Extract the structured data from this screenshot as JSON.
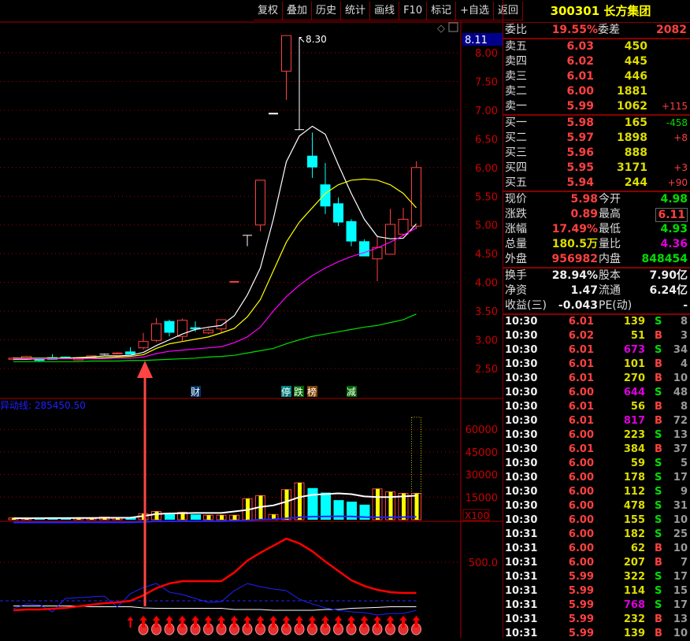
{
  "toolbar": [
    "复权",
    "叠加",
    "历史",
    "统计",
    "画线",
    "F10",
    "标记",
    "+自选",
    "返回"
  ],
  "stock": {
    "title": "300301 长方集团"
  },
  "weibi": {
    "label": "委比",
    "value": "19.55%",
    "label2": "委差",
    "value2": "2082"
  },
  "sell": [
    {
      "label": "卖五",
      "price": "6.03",
      "vol": "450",
      "chg": ""
    },
    {
      "label": "卖四",
      "price": "6.02",
      "vol": "445",
      "chg": ""
    },
    {
      "label": "卖三",
      "price": "6.01",
      "vol": "446",
      "chg": ""
    },
    {
      "label": "卖二",
      "price": "6.00",
      "vol": "1881",
      "chg": ""
    },
    {
      "label": "卖一",
      "price": "5.99",
      "vol": "1062",
      "chg": "+115"
    }
  ],
  "buy": [
    {
      "label": "买一",
      "price": "5.98",
      "vol": "165",
      "chg": "-458"
    },
    {
      "label": "买二",
      "price": "5.97",
      "vol": "1898",
      "chg": "+8"
    },
    {
      "label": "买三",
      "price": "5.96",
      "vol": "888",
      "chg": ""
    },
    {
      "label": "买四",
      "price": "5.95",
      "vol": "3171",
      "chg": "+3"
    },
    {
      "label": "买五",
      "price": "5.94",
      "vol": "244",
      "chg": "+90"
    }
  ],
  "quote": [
    {
      "l1": "现价",
      "v1": "5.98",
      "c1": "red",
      "l2": "今开",
      "v2": "4.98",
      "c2": "grn"
    },
    {
      "l1": "涨跌",
      "v1": "0.89",
      "c1": "red",
      "l2": "最高",
      "v2": "6.11",
      "c2": "red"
    },
    {
      "l1": "涨幅",
      "v1": "17.49%",
      "c1": "red",
      "l2": "最低",
      "v2": "4.93",
      "c2": "grn"
    },
    {
      "l1": "总量",
      "v1": "180.5万",
      "c1": "yel",
      "l2": "量比",
      "v2": "4.36",
      "c2": "mag"
    },
    {
      "l1": "外盘",
      "v1": "956982",
      "c1": "red",
      "l2": "内盘",
      "v2": "848454",
      "c2": "grn"
    }
  ],
  "fund": [
    {
      "l1": "换手",
      "v1": "28.94%",
      "l2": "股本",
      "v2": "7.90亿"
    },
    {
      "l1": "净资",
      "v1": "1.47",
      "l2": "流通",
      "v2": "6.24亿"
    },
    {
      "l1": "收益(三)",
      "v1": "-0.043",
      "l2": "PE(动)",
      "v2": "-"
    }
  ],
  "ticks": [
    [
      "10:30",
      "6.01",
      "139",
      "S",
      "8"
    ],
    [
      "10:30",
      "6.02",
      "51",
      "B",
      "3"
    ],
    [
      "10:30",
      "6.01",
      "673",
      "S",
      "34"
    ],
    [
      "10:30",
      "6.01",
      "101",
      "B",
      "4"
    ],
    [
      "10:30",
      "6.01",
      "270",
      "B",
      "10"
    ],
    [
      "10:30",
      "6.00",
      "644",
      "S",
      "48"
    ],
    [
      "10:30",
      "6.01",
      "56",
      "B",
      "8"
    ],
    [
      "10:30",
      "6.01",
      "817",
      "B",
      "72"
    ],
    [
      "10:30",
      "6.00",
      "223",
      "S",
      "13"
    ],
    [
      "10:30",
      "6.01",
      "384",
      "B",
      "37"
    ],
    [
      "10:30",
      "6.00",
      "59",
      "S",
      "5"
    ],
    [
      "10:30",
      "6.00",
      "178",
      "S",
      "17"
    ],
    [
      "10:30",
      "6.00",
      "112",
      "S",
      "9"
    ],
    [
      "10:30",
      "6.00",
      "478",
      "S",
      "31"
    ],
    [
      "10:30",
      "6.00",
      "155",
      "S",
      "10"
    ],
    [
      "10:31",
      "6.00",
      "182",
      "S",
      "25"
    ],
    [
      "10:31",
      "6.00",
      "62",
      "B",
      "10"
    ],
    [
      "10:31",
      "6.00",
      "207",
      "B",
      "7"
    ],
    [
      "10:31",
      "5.99",
      "322",
      "S",
      "17"
    ],
    [
      "10:31",
      "5.99",
      "114",
      "S",
      "15"
    ],
    [
      "10:31",
      "5.99",
      "768",
      "S",
      "17"
    ],
    [
      "10:31",
      "5.99",
      "232",
      "B",
      "13"
    ],
    [
      "10:31",
      "5.99",
      "139",
      "B",
      "10"
    ]
  ],
  "chart_labels": {
    "high_marker": "8.30",
    "current_axis": "8.11",
    "vol_title": "异动线: 285450.50",
    "vol_unit": "X100",
    "ind_axis": "500.0",
    "tags": [
      {
        "text": "财",
        "bg": "#003366"
      },
      {
        "text": "停",
        "bg": "#008080"
      },
      {
        "text": "跌",
        "bg": "#006600"
      },
      {
        "text": "榜",
        "bg": "#804000"
      },
      {
        "text": "减",
        "bg": "#006600"
      }
    ]
  },
  "colors": {
    "up": "#ff4040",
    "down": "#00ffff",
    "ma5": "#ffffff",
    "ma10": "#ffff00",
    "ma20": "#ff00ff",
    "ma60": "#00dd00",
    "grid": "#aa0000"
  },
  "chart_data": {
    "type": "candlestick",
    "price_ticks": [
      "8.00",
      "7.50",
      "7.00",
      "6.50",
      "6.00",
      "5.50",
      "5.00",
      "4.50",
      "4.00",
      "3.50",
      "3.00",
      "2.50"
    ],
    "vol_ticks": [
      "60000",
      "45000",
      "30000",
      "15000"
    ],
    "candles": [
      [
        2.66,
        2.7,
        2.64,
        2.68
      ],
      [
        2.66,
        2.72,
        2.65,
        2.71
      ],
      [
        2.66,
        2.68,
        2.62,
        2.64
      ],
      [
        2.69,
        2.75,
        2.68,
        2.66
      ],
      [
        2.7,
        2.71,
        2.68,
        2.69
      ],
      [
        2.65,
        2.7,
        2.64,
        2.69
      ],
      [
        2.7,
        2.73,
        2.69,
        2.72
      ],
      [
        2.75,
        2.76,
        2.74,
        2.75
      ],
      [
        2.76,
        2.78,
        2.75,
        2.77
      ],
      [
        2.79,
        2.87,
        2.76,
        2.75
      ],
      [
        2.86,
        3.12,
        2.83,
        2.97
      ],
      [
        2.99,
        3.38,
        2.96,
        3.28
      ],
      [
        3.32,
        3.35,
        3.06,
        3.13
      ],
      [
        3.06,
        3.37,
        2.98,
        3.34
      ],
      [
        3.21,
        3.32,
        3.14,
        3.19
      ],
      [
        3.12,
        3.2,
        3.1,
        3.17
      ],
      [
        3.19,
        3.35,
        3.13,
        3.35
      ],
      [
        4.01,
        4.01,
        4.01,
        4.01
      ],
      [
        4.82,
        4.82,
        4.63,
        4.82
      ],
      [
        5.0,
        5.78,
        4.89,
        5.78
      ],
      [
        6.94,
        6.94,
        6.94,
        6.94
      ],
      [
        7.68,
        8.3,
        7.18,
        8.3
      ],
      [
        6.66,
        8.25,
        6.66,
        6.66
      ],
      [
        6.2,
        6.61,
        5.82,
        6.01
      ],
      [
        5.7,
        6.08,
        5.19,
        5.33
      ],
      [
        5.37,
        5.48,
        4.98,
        5.05
      ],
      [
        5.06,
        5.1,
        4.63,
        4.72
      ],
      [
        4.71,
        4.75,
        4.46,
        4.46
      ],
      [
        4.41,
        4.82,
        4.02,
        4.61
      ],
      [
        4.49,
        5.28,
        4.49,
        5.01
      ],
      [
        4.84,
        5.3,
        4.8,
        5.1
      ],
      [
        4.98,
        6.11,
        4.93,
        6.0
      ]
    ],
    "ma5": [
      2.66,
      2.66,
      2.67,
      2.67,
      2.68,
      2.69,
      2.7,
      2.72,
      2.72,
      2.73,
      2.78,
      2.9,
      3.0,
      3.1,
      3.18,
      3.22,
      3.25,
      3.42,
      3.78,
      4.25,
      5.1,
      6.1,
      6.55,
      6.72,
      6.58,
      6.05,
      5.55,
      5.1,
      4.8,
      4.76,
      4.77,
      5.02
    ],
    "ma10": [
      2.68,
      2.68,
      2.68,
      2.68,
      2.68,
      2.68,
      2.68,
      2.69,
      2.7,
      2.71,
      2.74,
      2.85,
      2.93,
      2.97,
      3.01,
      3.05,
      3.12,
      3.2,
      3.4,
      3.7,
      4.2,
      4.7,
      5.05,
      5.3,
      5.55,
      5.7,
      5.78,
      5.8,
      5.78,
      5.7,
      5.55,
      5.3
    ],
    "ma20": [
      2.67,
      2.67,
      2.67,
      2.67,
      2.67,
      2.67,
      2.67,
      2.67,
      2.68,
      2.68,
      2.7,
      2.76,
      2.8,
      2.82,
      2.84,
      2.86,
      2.88,
      2.95,
      3.05,
      3.22,
      3.5,
      3.75,
      3.95,
      4.12,
      4.25,
      4.36,
      4.45,
      4.52,
      4.6,
      4.7,
      4.82,
      4.95
    ],
    "ma60": [
      2.62,
      2.62,
      2.62,
      2.62,
      2.62,
      2.62,
      2.63,
      2.63,
      2.63,
      2.64,
      2.64,
      2.65,
      2.66,
      2.67,
      2.68,
      2.7,
      2.71,
      2.73,
      2.77,
      2.81,
      2.85,
      2.93,
      3.0,
      3.06,
      3.1,
      3.14,
      3.18,
      3.22,
      3.25,
      3.3,
      3.35,
      3.45
    ],
    "volume": [
      1200,
      1000,
      1500,
      800,
      1500,
      1000,
      800,
      1800,
      1200,
      1500,
      4000,
      5500,
      4500,
      5000,
      3500,
      3000,
      3000,
      3000,
      14000,
      16000,
      3500,
      20000,
      24500,
      21000,
      18000,
      13000,
      12000,
      10000,
      20500,
      18500,
      17500,
      17500
    ],
    "volume_forecast": 68000,
    "vol_ma": [
      1000,
      1000,
      1000,
      1100,
      1100,
      1200,
      1200,
      1300,
      1300,
      1400,
      2500,
      3800,
      4200,
      4300,
      4500,
      4500,
      4500,
      5500,
      6500,
      8500,
      9500,
      12000,
      15000,
      16500,
      17000,
      17500,
      17000,
      15500,
      15000,
      15000,
      15500,
      16000
    ],
    "ind_red": [
      0,
      8,
      8,
      16,
      25,
      41,
      57,
      74,
      82,
      98,
      156,
      230,
      279,
      303,
      303,
      303,
      303,
      394,
      517,
      599,
      672,
      746,
      697,
      615,
      508,
      410,
      312,
      254,
      213,
      189,
      180,
      180
    ],
    "ind_blue": [
      16,
      66,
      57,
      -16,
      123,
      131,
      139,
      148,
      33,
      172,
      238,
      279,
      189,
      164,
      123,
      82,
      90,
      205,
      279,
      246,
      221,
      205,
      115,
      66,
      25,
      0,
      -16,
      -25,
      -49,
      -33,
      -33,
      0
    ],
    "ind_white": [
      45,
      45,
      45,
      45,
      45,
      45,
      37,
      37,
      37,
      37,
      25,
      20,
      20,
      20,
      20,
      20,
      20,
      8,
      8,
      8,
      0,
      0,
      0,
      0,
      8,
      8,
      20,
      25,
      30,
      37,
      37,
      37
    ],
    "ind_blue_ref": 98,
    "signal_start": 10
  }
}
